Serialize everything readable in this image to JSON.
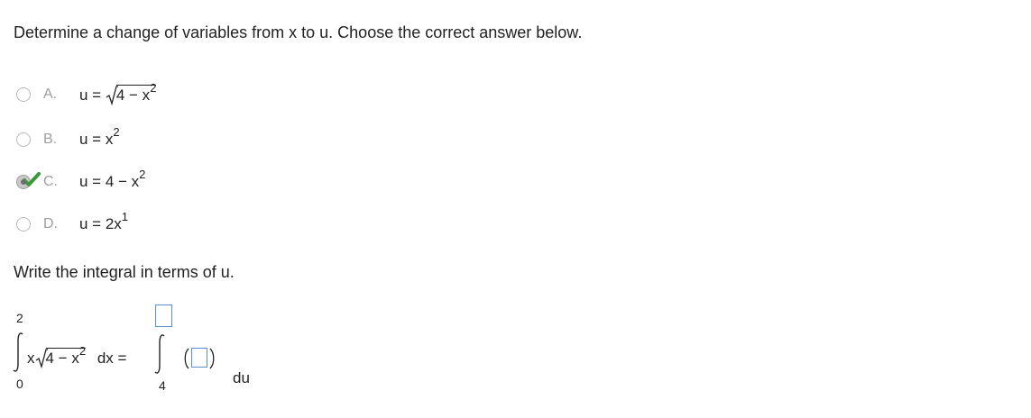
{
  "question": {
    "prompt": "Determine a change of variables from x to u. Choose the correct answer below."
  },
  "choices": [
    {
      "letter": "A.",
      "lhs": "u = ",
      "radicand": "4 − x",
      "exp": "2",
      "selected": false
    },
    {
      "letter": "B.",
      "lhs": "u = x",
      "exp": "2",
      "selected": false
    },
    {
      "letter": "C.",
      "lhs": "u = 4 − x",
      "exp": "2",
      "selected": true
    },
    {
      "letter": "D.",
      "lhs": "u = 2x",
      "exp": "1",
      "selected": false
    }
  ],
  "part2": {
    "prompt": "Write the integral in terms of u.",
    "left_integral": {
      "upper": "2",
      "lower": "0",
      "integrand_prefix": "x",
      "radicand": "4 − x",
      "exp": "2",
      "differential": "dx ="
    },
    "right_integral": {
      "lower": "4",
      "differential": "du"
    }
  },
  "colors": {
    "text": "#222222",
    "letter": "#9e9e9e",
    "check": "#3a9a3a",
    "answer_box_border": "#5b8fd3"
  },
  "icons": {
    "correct": "check-icon",
    "radio": "radio-button"
  }
}
